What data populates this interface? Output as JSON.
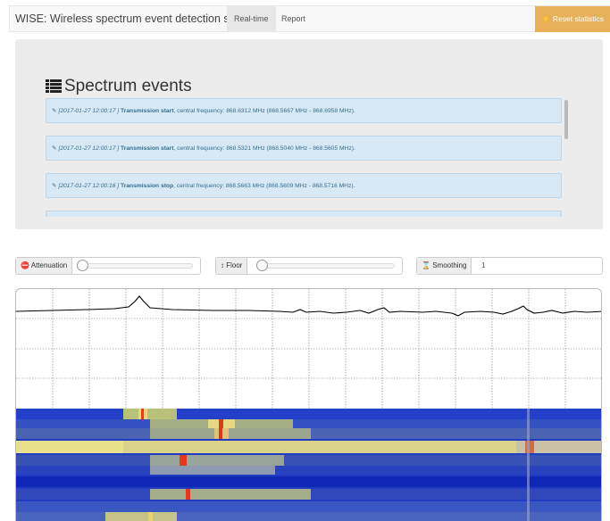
{
  "navbar": {
    "brand": "WISE: Wireless spectrum event detection system",
    "tabs": [
      {
        "label": "Real-time",
        "active": true
      },
      {
        "label": "Report",
        "active": false
      }
    ],
    "reset_label": "⚡ Reset statistics",
    "reset_color": "#e8b05a"
  },
  "events": {
    "title": "Spectrum events",
    "icon": "list-icon",
    "items": [
      {
        "icon": "bullhorn-icon",
        "timestamp": "[2017-01-27 12:00:17 ]",
        "kind": "Transmission start",
        "detail": ", central frequency: 868.6312 MHz (868.5667 MHz - 868.6958 MHz)."
      },
      {
        "icon": "bullhorn-icon",
        "timestamp": "[2017-01-27 12:00:17 ]",
        "kind": "Transmission start",
        "detail": ", central frequency: 868.5321 MHz (868.5040 MHz - 868.5605 MHz)."
      },
      {
        "icon": "bullhorn-icon",
        "timestamp": "[2017-01-27 12:00:16 ]",
        "kind": "Transmission stop",
        "detail": ", central frequency: 868.5663 MHz (868.5609 MHz - 868.5716 MHz)."
      }
    ]
  },
  "controls": {
    "attenuation": {
      "label": "Attenuation",
      "icon": "minus-circle-icon",
      "value": 0
    },
    "floor": {
      "label": "Floor",
      "icon": "vertical-arrows-icon",
      "value": 0
    },
    "smoothing": {
      "label": "Smoothing",
      "icon": "hourglass-icon",
      "value": "1"
    }
  },
  "spectrum": {
    "trace_color": "#000000",
    "waterfall_colors": {
      "low": "#1a2fb8",
      "mid": "#e8e08a",
      "high": "#e03a1e"
    }
  }
}
